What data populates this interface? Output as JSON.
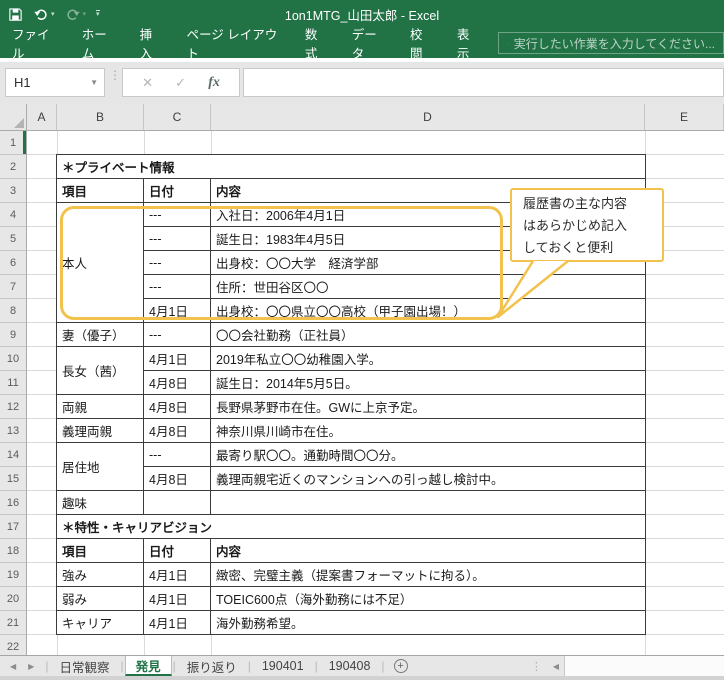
{
  "titlebar": {
    "title": "1on1MTG_山田太郎 - Excel"
  },
  "ribbon": {
    "tabs": [
      {
        "id": "file",
        "label": "ファイル"
      },
      {
        "id": "home",
        "label": "ホーム"
      },
      {
        "id": "insert",
        "label": "挿入"
      },
      {
        "id": "page-layout",
        "label": "ページ レイアウト"
      },
      {
        "id": "formulas",
        "label": "数式"
      },
      {
        "id": "data",
        "label": "データ"
      },
      {
        "id": "review",
        "label": "校閲"
      },
      {
        "id": "view",
        "label": "表示"
      }
    ],
    "tellme_placeholder": "実行したい作業を入力してください..."
  },
  "formula_bar": {
    "name_box_value": "H1",
    "fx_label": "fx",
    "formula_value": ""
  },
  "grid": {
    "column_letters": [
      "A",
      "B",
      "C",
      "D",
      "E"
    ],
    "row_count": 22,
    "selected_row": 1
  },
  "table": {
    "rows": [
      {
        "r": 2,
        "type": "section",
        "text": "＊プライベート情報"
      },
      {
        "r": 3,
        "type": "header",
        "cells": [
          "項目",
          "日付",
          "内容"
        ]
      },
      {
        "r": 4,
        "type": "data",
        "item": "本人",
        "item_span": 5,
        "date": "---",
        "content": "入社日：2006年4月1日"
      },
      {
        "r": 5,
        "type": "data",
        "date": "---",
        "content": "誕生日：1983年4月5日"
      },
      {
        "r": 6,
        "type": "data",
        "date": "---",
        "content": "出身校：〇〇大学　経済学部"
      },
      {
        "r": 7,
        "type": "data",
        "date": "---",
        "content": "住所：世田谷区〇〇"
      },
      {
        "r": 8,
        "type": "data",
        "date": "4月1日",
        "content": "出身校：〇〇県立〇〇高校（甲子園出場！）"
      },
      {
        "r": 9,
        "type": "data",
        "item": "妻（優子）",
        "item_span": 1,
        "date": "---",
        "content": "〇〇会社勤務（正社員）"
      },
      {
        "r": 10,
        "type": "data",
        "item": "長女（茜）",
        "item_span": 2,
        "date": "4月1日",
        "content": "2019年私立〇〇幼稚園入学。"
      },
      {
        "r": 11,
        "type": "data",
        "date": "4月8日",
        "content": "誕生日：2014年5月5日。"
      },
      {
        "r": 12,
        "type": "data",
        "item": "両親",
        "item_span": 1,
        "date": "4月8日",
        "content": "長野県茅野市在住。GWに上京予定。"
      },
      {
        "r": 13,
        "type": "data",
        "item": "義理両親",
        "item_span": 1,
        "date": "4月8日",
        "content": "神奈川県川崎市在住。"
      },
      {
        "r": 14,
        "type": "data",
        "item": "居住地",
        "item_span": 2,
        "date": "---",
        "content": "最寄り駅〇〇。通勤時間〇〇分。"
      },
      {
        "r": 15,
        "type": "data",
        "date": "4月8日",
        "content": "義理両親宅近くのマンションへの引っ越し検討中。"
      },
      {
        "r": 16,
        "type": "data",
        "item": "趣味",
        "item_span": 1,
        "date": "",
        "content": ""
      },
      {
        "r": 17,
        "type": "section",
        "text": "＊特性・キャリアビジョン"
      },
      {
        "r": 18,
        "type": "header",
        "cells": [
          "項目",
          "日付",
          "内容"
        ]
      },
      {
        "r": 19,
        "type": "data",
        "item": "強み",
        "item_span": 1,
        "date": "4月1日",
        "content": "緻密、完璧主義（提案書フォーマットに拘る）。"
      },
      {
        "r": 20,
        "type": "data",
        "item": "弱み",
        "item_span": 1,
        "date": "4月1日",
        "content": "TOEIC600点（海外勤務には不足）"
      },
      {
        "r": 21,
        "type": "data",
        "item": "キャリア",
        "item_span": 1,
        "date": "4月1日",
        "content": "海外勤務希望。"
      }
    ]
  },
  "callout": {
    "lines": [
      "履歴書の主な内容",
      "はあらかじめ記入",
      "しておくと便利"
    ]
  },
  "sheet_tabs": {
    "tabs": [
      {
        "id": "daily-observation",
        "label": "日常観察",
        "active": false
      },
      {
        "id": "discovery",
        "label": "発見",
        "active": true
      },
      {
        "id": "reflection",
        "label": "振り返り",
        "active": false
      },
      {
        "id": "190401",
        "label": "190401",
        "active": false
      },
      {
        "id": "190408",
        "label": "190408",
        "active": false
      }
    ],
    "add_sheet_label": "+"
  },
  "colors": {
    "excel_green": "#217346",
    "table_header_gray": "#9f9f9f",
    "highlight_yellow": "#f2c24d"
  }
}
